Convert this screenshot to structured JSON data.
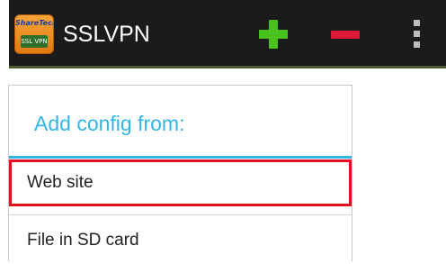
{
  "actionbar": {
    "app_icon": {
      "name": "sslvpn-app-icon",
      "brand_text": "ShareTech",
      "tag_text": "SSL VPN"
    },
    "title": "SSLVPN",
    "actions": [
      {
        "name": "add-icon",
        "color": "#48c21f"
      },
      {
        "name": "remove-icon",
        "color": "#e01838"
      },
      {
        "name": "overflow-menu-icon",
        "color": "#bdbdbd"
      }
    ]
  },
  "dialog": {
    "title": "Add config from:",
    "title_color": "#33b5e5",
    "options": [
      {
        "label": "Web site",
        "highlighted": true,
        "highlight_color": "#e0101e"
      },
      {
        "label": "File in SD card",
        "highlighted": false
      }
    ]
  }
}
